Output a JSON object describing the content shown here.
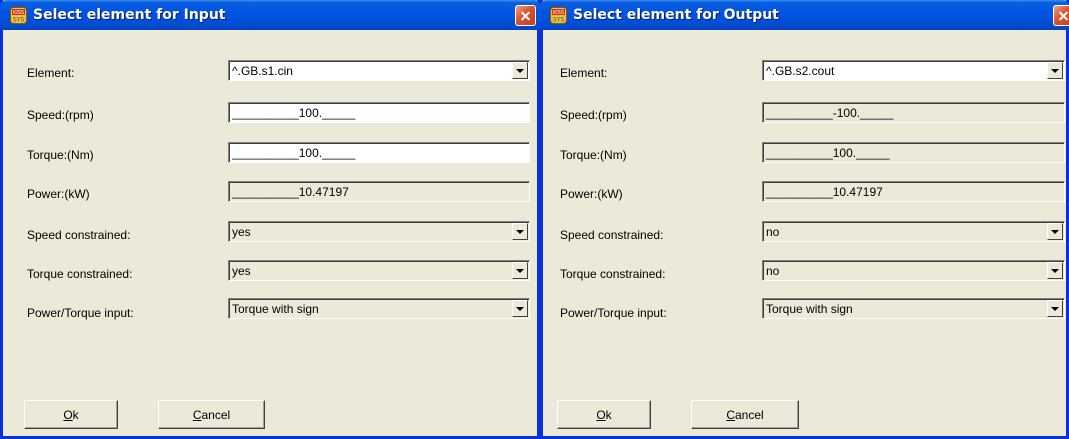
{
  "dialogs": [
    {
      "title": "Select element for Input",
      "rows": {
        "element": {
          "label": "Element:",
          "value": "^.GB.s1.cin"
        },
        "speed": {
          "label": "Speed:(rpm)",
          "value": "__________100._____"
        },
        "torque": {
          "label": "Torque:(Nm)",
          "value": "__________100._____"
        },
        "power": {
          "label": "Power:(kW)",
          "value": "__________10.47197"
        },
        "speed_constrained": {
          "label": "Speed constrained:",
          "value": "yes"
        },
        "torque_constrained": {
          "label": "Torque constrained:",
          "value": "yes"
        },
        "power_torque_input": {
          "label": "Power/Torque input:",
          "value": "Torque with sign"
        }
      },
      "ok_mnemonic": "O",
      "ok_rest": "k",
      "cancel_mnemonic": "C",
      "cancel_rest": "ancel"
    },
    {
      "title": "Select element for Output",
      "rows": {
        "element": {
          "label": "Element:",
          "value": "^.GB.s2.cout"
        },
        "speed": {
          "label": "Speed:(rpm)",
          "value": "__________-100._____"
        },
        "torque": {
          "label": "Torque:(Nm)",
          "value": "__________100._____"
        },
        "power": {
          "label": "Power:(kW)",
          "value": "__________10.47197"
        },
        "speed_constrained": {
          "label": "Speed constrained:",
          "value": "no"
        },
        "torque_constrained": {
          "label": "Torque constrained:",
          "value": "no"
        },
        "power_torque_input": {
          "label": "Power/Torque input:",
          "value": "Torque with sign"
        }
      },
      "ok_mnemonic": "O",
      "ok_rest": "k",
      "cancel_mnemonic": "C",
      "cancel_rest": "ancel"
    }
  ],
  "icons": {
    "app": "kiss-app-icon",
    "close": "close-icon",
    "dropdown": "chevron-down-icon"
  },
  "colors": {
    "titlebar": "#0054e3",
    "close": "#d9542d",
    "face": "#ece9d8",
    "frame": "#0831d9"
  }
}
